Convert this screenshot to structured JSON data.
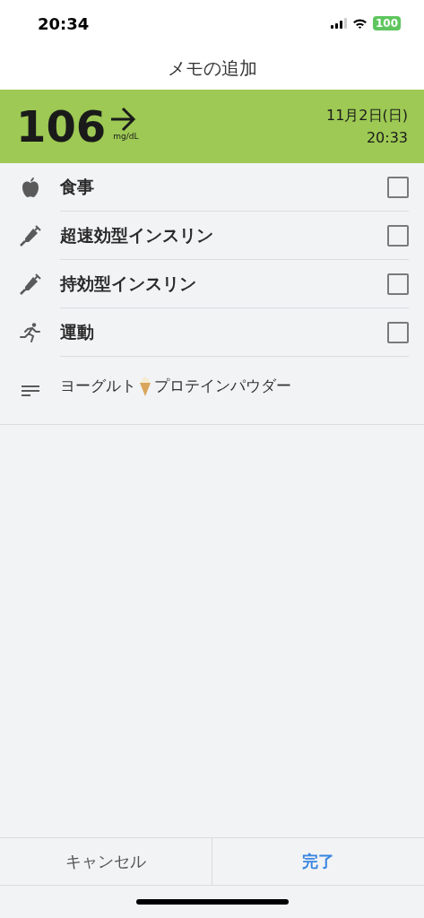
{
  "status_bar": {
    "time": "20:34",
    "battery": "100"
  },
  "title": "メモの追加",
  "reading": {
    "value": "106",
    "unit": "mg/dL",
    "date": "11月2日(日)",
    "time": "20:33",
    "color": "#9dc954"
  },
  "items": [
    {
      "kind": "meal",
      "label": "食事",
      "checked": false
    },
    {
      "kind": "insulin",
      "label": "超速効型インスリン",
      "checked": false
    },
    {
      "kind": "insulin",
      "label": "持効型インスリン",
      "checked": false
    },
    {
      "kind": "exercise",
      "label": "運動",
      "checked": false
    }
  ],
  "note": [
    {
      "kind": "text",
      "text": "ヨーグルト"
    },
    {
      "kind": "emoji"
    },
    {
      "kind": "text",
      "text": "プロテインパウダー"
    }
  ],
  "buttons": [
    {
      "kind": "cancel",
      "label": "キャンセル"
    },
    {
      "kind": "done",
      "label": "完了"
    }
  ]
}
